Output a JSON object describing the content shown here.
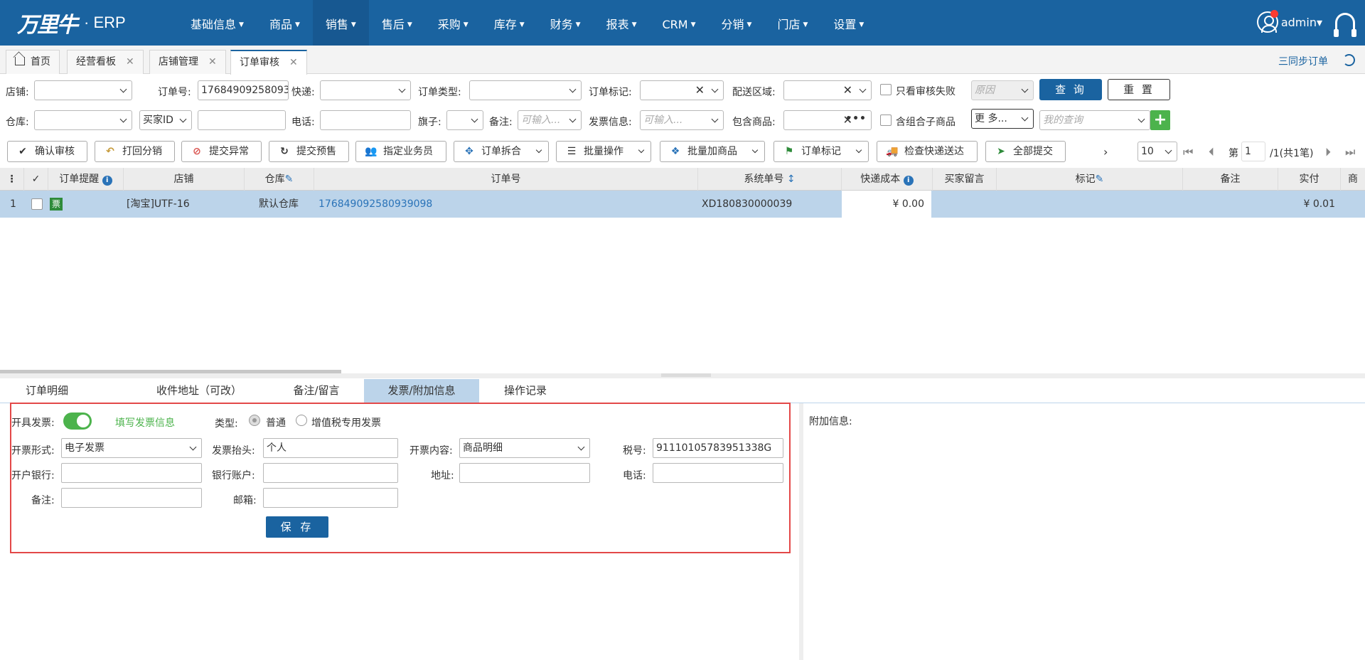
{
  "app": {
    "logo_text": "万里牛",
    "logo_dot": "·",
    "product": "ERP"
  },
  "nav": {
    "items": [
      {
        "label": "基础信息",
        "caret": "▼"
      },
      {
        "label": "商品",
        "caret": "▼"
      },
      {
        "label": "销售",
        "caret": "▼"
      },
      {
        "label": "售后",
        "caret": "▼"
      },
      {
        "label": "采购",
        "caret": "▼"
      },
      {
        "label": "库存",
        "caret": "▼"
      },
      {
        "label": "财务",
        "caret": "▼"
      },
      {
        "label": "报表",
        "caret": "▼"
      },
      {
        "label": "CRM",
        "caret": "▼"
      },
      {
        "label": "分销",
        "caret": "▼"
      },
      {
        "label": "门店",
        "caret": "▼"
      },
      {
        "label": "设置",
        "caret": "▼"
      }
    ],
    "active_index": 2,
    "user": "admin",
    "user_caret": "▾"
  },
  "tabs": [
    {
      "label": "首页"
    },
    {
      "label": "经营看板",
      "close": "✕"
    },
    {
      "label": "店铺管理",
      "close": "✕"
    },
    {
      "label": "订单审核",
      "close": "✕"
    }
  ],
  "sync_label": "三同步订单",
  "filters": {
    "shop": "店铺:",
    "order_no": "订单号:",
    "order_no_value": "17684909258093",
    "express": "快递:",
    "order_type": "订单类型:",
    "order_mark": "订单标记:",
    "delivery_area": "配送区域:",
    "only_failed": "只看审核失败",
    "reason_ph": "原因",
    "query": "查 询",
    "reset": "重 置",
    "warehouse": "仓库:",
    "buyer_id": "买家ID",
    "phone": "电话:",
    "flag": "旗子:",
    "remark": "备注:",
    "remark_ph": "可输入...",
    "invoice_info": "发票信息:",
    "invoice_ph": "可输入...",
    "contains_goods": "包含商品:",
    "combo_sub": "含组合子商品",
    "more": "更 多...",
    "my_query_ph": "我的查询",
    "clear": "✕",
    "more_dots": "•••",
    "add": "+"
  },
  "toolbar": [
    {
      "icon": "✔",
      "label": "确认审核"
    },
    {
      "icon": "↶",
      "label": "打回分销"
    },
    {
      "icon": "⊘",
      "label": "提交异常"
    },
    {
      "icon": "↻",
      "label": "提交预售"
    },
    {
      "icon": "👥",
      "label": "指定业务员"
    },
    {
      "icon": "✥",
      "label": "订单拆合"
    },
    {
      "icon": "☰",
      "label": "批量操作"
    },
    {
      "icon": "❖",
      "label": "批量加商品"
    },
    {
      "icon": "⚑",
      "label": "订单标记"
    },
    {
      "icon": "🚚",
      "label": "检查快递送达"
    },
    {
      "icon": "➤",
      "label": "全部提交"
    }
  ],
  "pager": {
    "arrow": "›",
    "page_size": "10",
    "page_prefix": "第",
    "page": "1",
    "page_suffix": "/1(共1笔)",
    "first": "⏮",
    "prev": "⏴",
    "next": "⏵",
    "last": "⏭"
  },
  "grid": {
    "headers": {
      "menu": "⋮",
      "check": "✓",
      "reminder": "订单提醒",
      "shop": "店铺",
      "warehouse": "仓库",
      "order_no": "订单号",
      "sys_no": "系统单号",
      "express_cost": "快递成本",
      "buyer_msg": "买家留言",
      "mark": "标记",
      "remark": "备注",
      "paid": "实付",
      "more": "商"
    },
    "sort_glyph": "↕",
    "info_glyph": "i",
    "edit_glyph": "✎",
    "rows": [
      {
        "index": "1",
        "badge": "票",
        "shop": "[淘宝]UTF-16",
        "warehouse": "默认仓库",
        "order_no": "176849092580939098",
        "sys_no": "XD180830000039",
        "express_cost": "¥ 0.00",
        "paid": "¥ 0.01"
      }
    ]
  },
  "bottom_tabs": [
    "订单明细",
    "收件地址（可改）",
    "备注/留言",
    "发票/附加信息",
    "操作记录"
  ],
  "invoice": {
    "open_invoice": "开具发票:",
    "fill_info": "填写发票信息",
    "type": "类型:",
    "type_normal": "普通",
    "type_vat": "增值税专用发票",
    "form": "开票形式:",
    "form_value": "电子发票",
    "title": "发票抬头:",
    "title_value": "个人",
    "content": "开票内容:",
    "content_value": "商品明细",
    "tax_no": "税号:",
    "tax_no_value": "91110105783951338G",
    "bank": "开户银行:",
    "bank_account": "银行账户:",
    "address": "地址:",
    "phone": "电话:",
    "remark": "备注:",
    "email": "邮箱:",
    "save": "保 存"
  },
  "extra_info": "附加信息:"
}
